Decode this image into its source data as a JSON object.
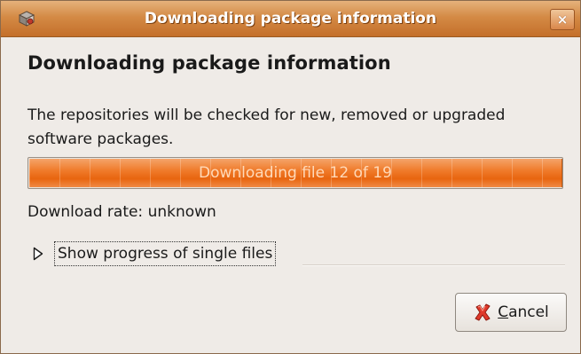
{
  "window": {
    "title": "Downloading package information",
    "close_glyph": "×",
    "app_icon": "package-icon"
  },
  "main": {
    "heading": "Downloading package information",
    "description": "The repositories will be checked for new, removed or upgraded software packages.",
    "progress": {
      "text": "Downloading file 12 of 19",
      "fraction": 1.0,
      "color": "#f07c2c"
    },
    "download_rate": "Download rate: unknown",
    "expander": {
      "label": "Show progress of single files",
      "expanded": false
    }
  },
  "buttons": {
    "cancel_mnemonic": "C",
    "cancel_rest": "ancel",
    "cancel_icon": "cancel-x-icon"
  },
  "colors": {
    "titlebar": "#d48a45",
    "accent": "#f07c2c",
    "background": "#efebe7"
  }
}
